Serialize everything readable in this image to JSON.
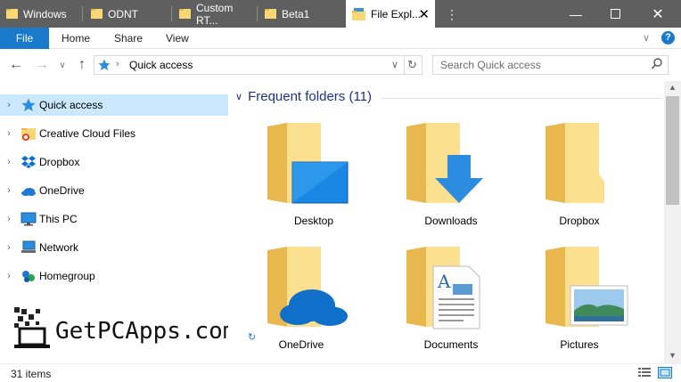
{
  "tabs": [
    {
      "label": "Windows"
    },
    {
      "label": "ODNT"
    },
    {
      "label": "Custom RT..."
    },
    {
      "label": "Beta1"
    },
    {
      "label": "File Expl..."
    }
  ],
  "ribbon": {
    "file": "File",
    "home": "Home",
    "share": "Share",
    "view": "View"
  },
  "address": {
    "crumb": "Quick access"
  },
  "search": {
    "placeholder": "Search Quick access"
  },
  "nav": [
    {
      "label": "Quick access",
      "icon": "star-icon"
    },
    {
      "label": "Creative Cloud Files",
      "icon": "creative-cloud-icon"
    },
    {
      "label": "Dropbox",
      "icon": "dropbox-icon"
    },
    {
      "label": "OneDrive",
      "icon": "onedrive-icon"
    },
    {
      "label": "This PC",
      "icon": "computer-icon"
    },
    {
      "label": "Network",
      "icon": "network-icon"
    },
    {
      "label": "Homegroup",
      "icon": "homegroup-icon"
    }
  ],
  "group": {
    "title": "Frequent folders (11)"
  },
  "folders": [
    {
      "label": "Desktop"
    },
    {
      "label": "Downloads"
    },
    {
      "label": "Dropbox"
    },
    {
      "label": "OneDrive"
    },
    {
      "label": "Documents"
    },
    {
      "label": "Pictures"
    }
  ],
  "status": {
    "items": "31 items"
  },
  "watermark": {
    "text": "GetPCApps.com"
  },
  "colors": {
    "accent": "#1979ca",
    "selected": "#cce8ff",
    "folder": "#f8d775",
    "tabbar": "#5f5f5f"
  }
}
